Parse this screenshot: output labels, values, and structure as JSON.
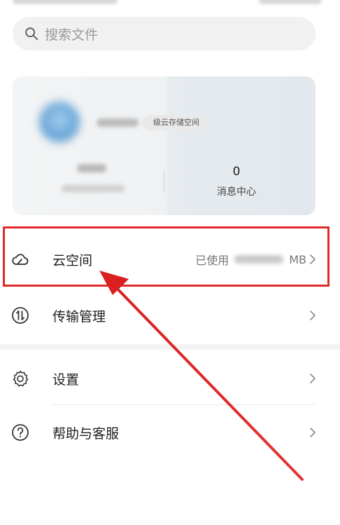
{
  "search": {
    "placeholder": "搜索文件"
  },
  "account_card": {
    "level_tag": "级云存储空间",
    "message_count": "0",
    "message_label": "消息中心"
  },
  "menu": {
    "cloud_space": {
      "label": "云空间",
      "usage_prefix": "已使用",
      "usage_unit": "MB"
    },
    "transfer": {
      "label": "传输管理"
    },
    "settings": {
      "label": "设置"
    },
    "help": {
      "label": "帮助与客服"
    }
  },
  "icons": {
    "search": "search-icon",
    "cloud": "cloud-icon",
    "transfer": "transfer-icon",
    "settings": "gear-icon",
    "help": "question-icon",
    "chevron": "chevron-right-icon"
  },
  "annotation": {
    "highlight_color": "#e02a2a"
  }
}
